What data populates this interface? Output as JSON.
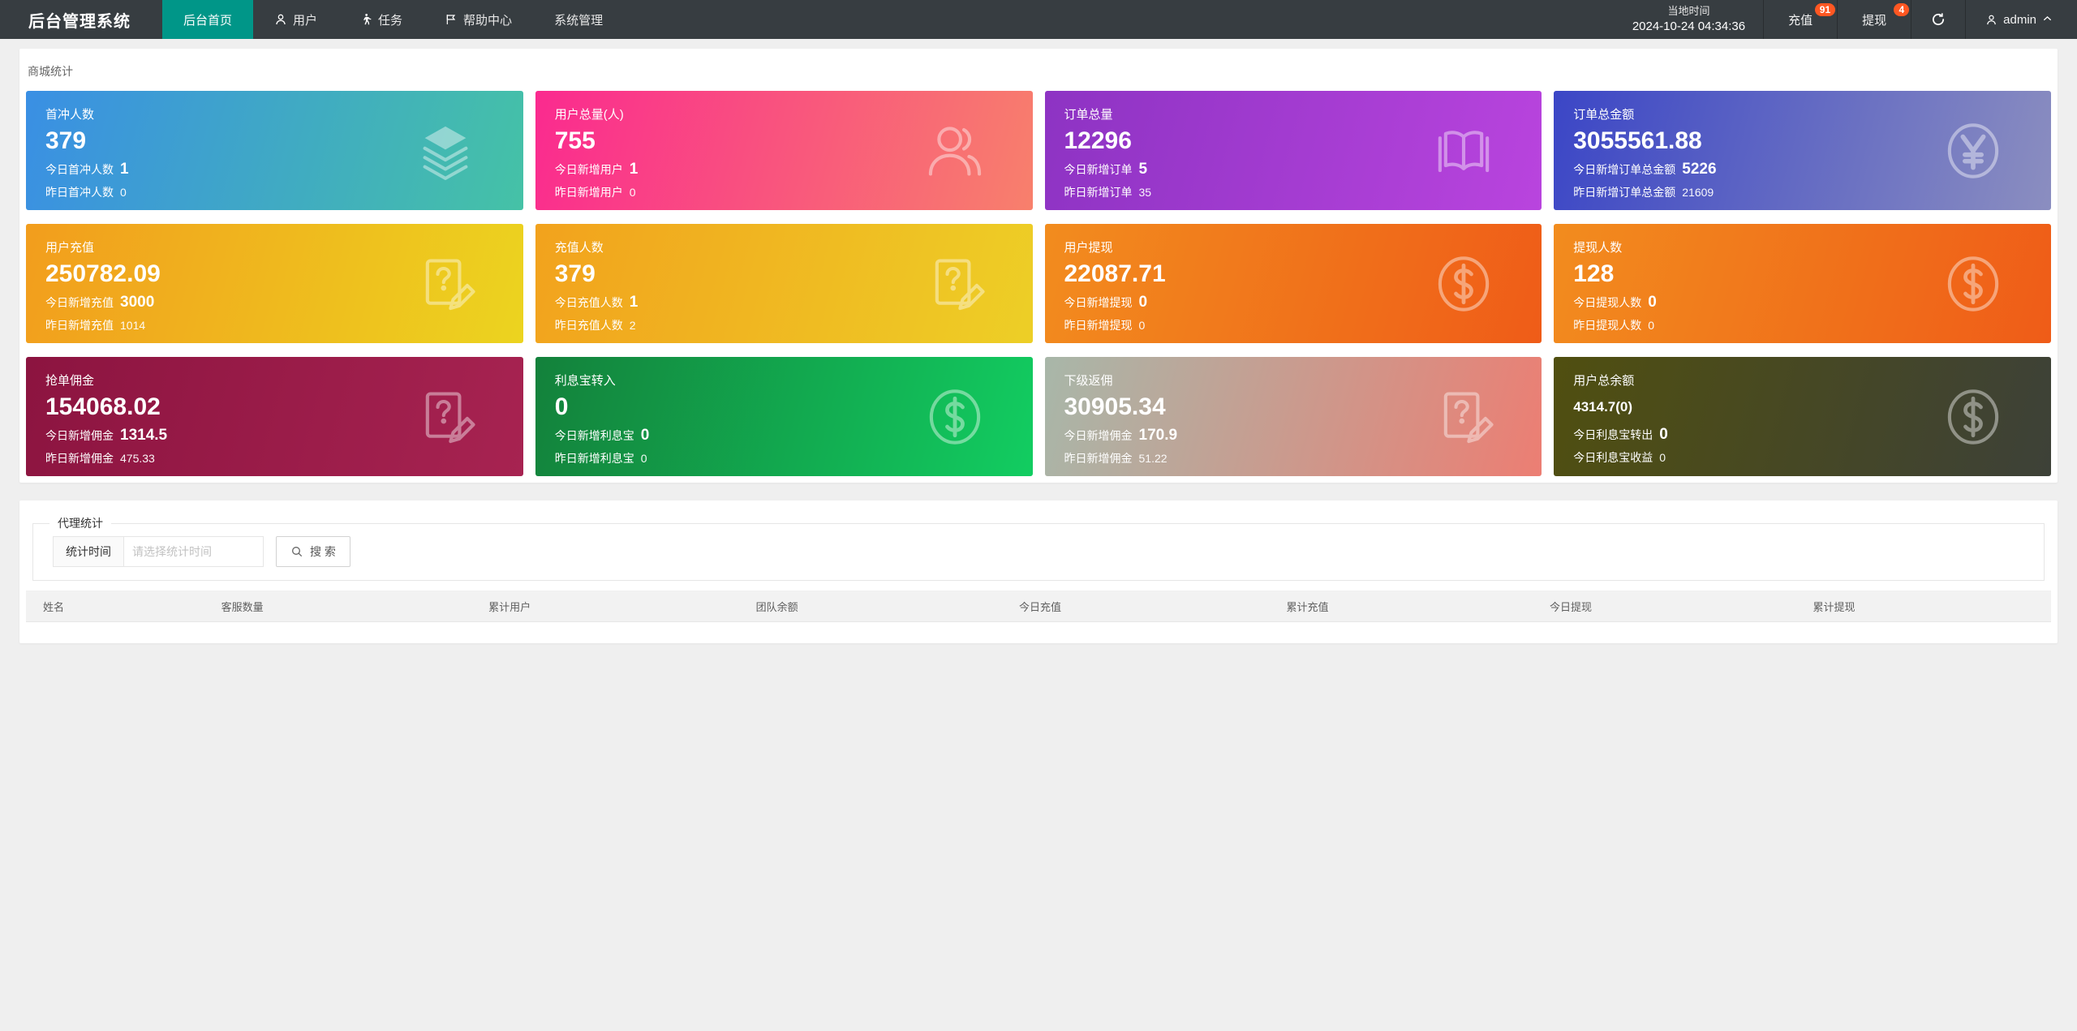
{
  "colors": {
    "navbar_bg": "#373d41",
    "active_tab": "#009688",
    "badge": "#ff5722",
    "page_bg": "#efefef"
  },
  "navbar": {
    "brand": "后台管理系统",
    "menu": [
      {
        "label": "后台首页",
        "icon": null,
        "active": true
      },
      {
        "label": "用户",
        "icon": "user-icon",
        "active": false
      },
      {
        "label": "任务",
        "icon": "walking-person-icon",
        "active": false
      },
      {
        "label": "帮助中心",
        "icon": "flag-icon",
        "active": false
      },
      {
        "label": "系统管理",
        "icon": null,
        "active": false
      }
    ],
    "local_time_label": "当地时间",
    "local_time_value": "2024-10-24 04:34:36",
    "recharge": {
      "label": "充值",
      "badge": "91"
    },
    "withdraw": {
      "label": "提现",
      "badge": "4"
    },
    "user": {
      "name": "admin"
    }
  },
  "stats": {
    "section_title": "商城统计",
    "cards": [
      {
        "label": "首冲人数",
        "value": "379",
        "line1_label": "今日首冲人数",
        "line1_value": "1",
        "line2_label": "昨日首冲人数",
        "line2_value": "0",
        "icon": "layers-icon",
        "from": "#3a8fe4",
        "to": "#45c2a6"
      },
      {
        "label": "用户总量(人)",
        "value": "755",
        "line1_label": "今日新增用户",
        "line1_value": "1",
        "line2_label": "昨日新增用户",
        "line2_value": "0",
        "icon": "users-icon",
        "from": "#fa2a8f",
        "to": "#f8806c"
      },
      {
        "label": "订单总量",
        "value": "12296",
        "line1_label": "今日新增订单",
        "line1_value": "5",
        "line2_label": "昨日新增订单",
        "line2_value": "35",
        "icon": "open-book-icon",
        "from": "#8d33c3",
        "to": "#b944de"
      },
      {
        "label": "订单总金额",
        "value": "3055561.88",
        "line1_label": "今日新增订单总金额",
        "line1_value": "5226",
        "line2_label": "昨日新增订单总金额",
        "line2_value": "21609",
        "icon": "yen-circle-icon",
        "from": "#3b46c6",
        "to": "#8b8ec0"
      },
      {
        "label": "用户充值",
        "value": "250782.09",
        "line1_label": "今日新增充值",
        "line1_value": "3000",
        "line2_label": "昨日新增充值",
        "line2_value": "1014",
        "icon": "edit-document-icon",
        "from": "#f29d1d",
        "to": "#ecd41f"
      },
      {
        "label": "充值人数",
        "value": "379",
        "line1_label": "今日充值人数",
        "line1_value": "1",
        "line2_label": "昨日充值人数",
        "line2_value": "2",
        "icon": "edit-document-icon",
        "from": "#f2a21d",
        "to": "#edcf26"
      },
      {
        "label": "用户提现",
        "value": "22087.71",
        "line1_label": "今日新增提现",
        "line1_value": "0",
        "line2_label": "昨日新增提现",
        "line2_value": "0",
        "icon": "dollar-circle-icon",
        "from": "#f28c1e",
        "to": "#ef5c18"
      },
      {
        "label": "提现人数",
        "value": "128",
        "line1_label": "今日提现人数",
        "line1_value": "0",
        "line2_label": "昨日提现人数",
        "line2_value": "0",
        "icon": "dollar-circle-icon",
        "from": "#f28c1e",
        "to": "#ef5c18"
      },
      {
        "label": "抢单佣金",
        "value": "154068.02",
        "line1_label": "今日新增佣金",
        "line1_value": "1314.5",
        "line2_label": "昨日新增佣金",
        "line2_value": "475.33",
        "icon": "edit-document-icon",
        "from": "#8c1440",
        "to": "#a72351"
      },
      {
        "label": "利息宝转入",
        "value": "0",
        "line1_label": "今日新增利息宝",
        "line1_value": "0",
        "line2_label": "昨日新增利息宝",
        "line2_value": "0",
        "icon": "dollar-circle-icon",
        "from": "#13813b",
        "to": "#12cd61"
      },
      {
        "label": "下级返佣",
        "value": "30905.34",
        "line1_label": "今日新增佣金",
        "line1_value": "170.9",
        "line2_label": "昨日新增佣金",
        "line2_value": "51.22",
        "icon": "edit-document-icon",
        "from": "#a8b7a9",
        "to": "#ec7e73"
      },
      {
        "label": "用户总余额",
        "value": "4314.7(0)",
        "small_value": true,
        "line1_label": "今日利息宝转出",
        "line1_value": "0",
        "line2_label": "今日利息宝收益",
        "line2_value": "0",
        "icon": "dollar-circle-icon",
        "from": "#504f10",
        "to": "#3d4138"
      }
    ]
  },
  "agent": {
    "fieldset_title": "代理统计",
    "time_label": "统计时间",
    "time_placeholder": "请选择统计时间",
    "search_label": "搜 索"
  },
  "table": {
    "headers": [
      "姓名",
      "客服数量",
      "累计用户",
      "团队余额",
      "今日充值",
      "累计充值",
      "今日提现",
      "累计提现"
    ],
    "rows": []
  }
}
